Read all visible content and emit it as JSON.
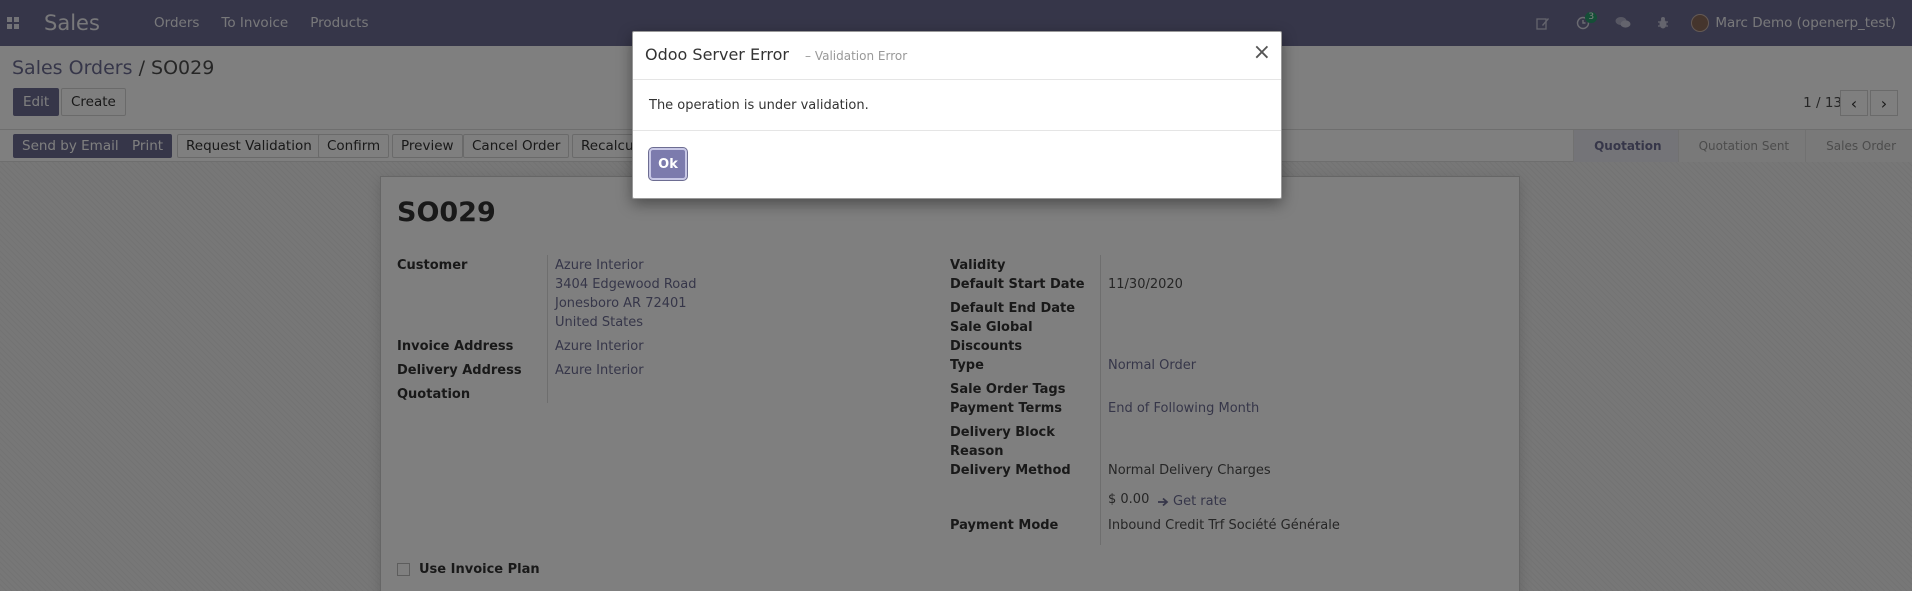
{
  "navbar": {
    "app_name": "Sales",
    "menu": [
      "Orders",
      "To Invoice",
      "Products"
    ],
    "activity_count": "3",
    "user": "Marc Demo (openerp_test)"
  },
  "control": {
    "breadcrumb_parent": "Sales Orders",
    "breadcrumb_sep": "/",
    "breadcrumb_current": "SO029",
    "edit_label": "Edit",
    "create_label": "Create",
    "pager": "1 / 13"
  },
  "statusbar": {
    "buttons": [
      "Send by Email",
      "Print",
      "Request Validation",
      "Confirm",
      "Preview",
      "Cancel Order",
      "Recalcul"
    ],
    "stages": [
      "Quotation",
      "Quotation Sent",
      "Sales Order"
    ],
    "active_stage": "Quotation"
  },
  "form": {
    "title": "SO029",
    "customer_label": "Customer",
    "customer_name": "Azure Interior",
    "customer_street": "3404 Edgewood Road",
    "customer_city": "Jonesboro AR 72401",
    "customer_country": "United States",
    "invoice_address_label": "Invoice Address",
    "invoice_address": "Azure Interior",
    "delivery_address_label": "Delivery Address",
    "delivery_address": "Azure Interior",
    "quotation_label": "Quotation",
    "validity_label": "Validity",
    "default_start_label": "Default Start Date",
    "default_start": "11/30/2020",
    "default_end_label": "Default End Date",
    "sale_global_label": "Sale Global",
    "discounts_label": "Discounts",
    "type_label": "Type",
    "type_value": "Normal Order",
    "tags_label": "Sale Order Tags",
    "payment_terms_label": "Payment Terms",
    "payment_terms": "End of Following Month",
    "delivery_block_label": "Delivery Block",
    "reason_label": "Reason",
    "delivery_method_label": "Delivery Method",
    "delivery_method": "Normal Delivery Charges",
    "delivery_price": "$ 0.00",
    "get_rate": "Get rate",
    "payment_mode_label": "Payment Mode",
    "payment_mode": "Inbound Credit Trf Société Générale",
    "invoice_plan_label": "Use Invoice Plan"
  },
  "modal": {
    "title": "Odoo Server Error",
    "subtitle": "– Validation Error",
    "message": "The operation is under validation.",
    "ok_label": "Ok",
    "close_glyph": "×"
  },
  "colors": {
    "brand": "#6d6d92",
    "link": "#6d6d92",
    "badge": "#2b9d6e"
  }
}
